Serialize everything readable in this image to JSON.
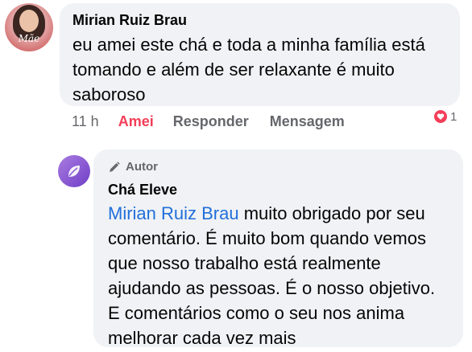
{
  "comment": {
    "author": "Mirian Ruiz Brau",
    "avatar_text": "Mãe",
    "text": "eu amei este chá e toda a minha família está tomando e além de ser relaxante é muito saboroso",
    "time": "11 h",
    "actions": {
      "like": "Amei",
      "reply": "Responder",
      "message": "Mensagem"
    },
    "reaction": {
      "icon": "heart-icon",
      "count": "1",
      "color": "#f33e58"
    }
  },
  "reply": {
    "badge": "Autor",
    "author": "Chá Eleve",
    "mention": "Mirian Ruiz Brau",
    "text": " muito obrigado por seu comentário. É muito bom quando vemos que nosso trabalho está realmente ajudando as pessoas. É o nosso objetivo. E comentários como o seu nos anima melhorar cada vez mais",
    "mention_color": "#216fdb"
  }
}
